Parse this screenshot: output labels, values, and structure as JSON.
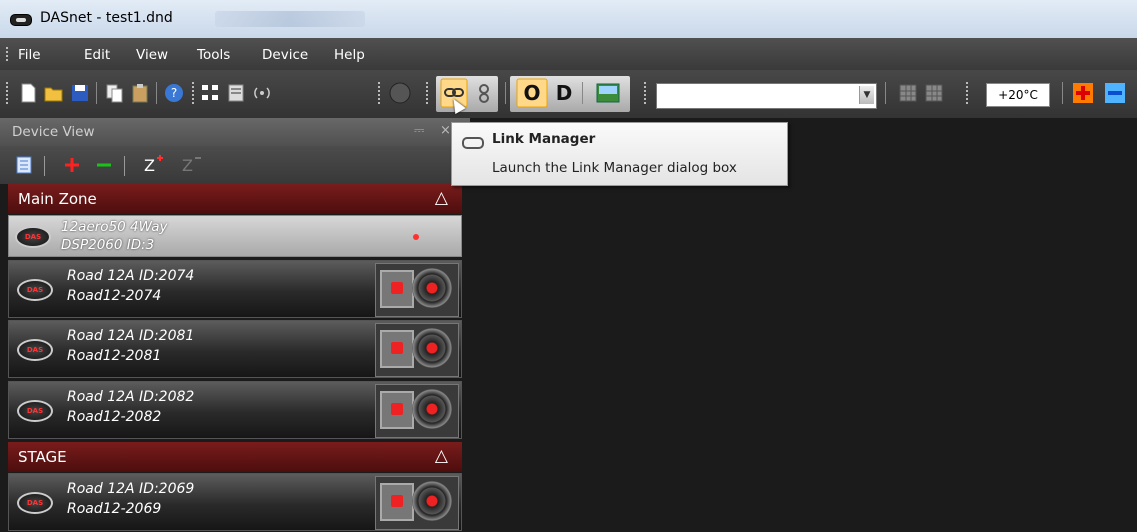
{
  "window": {
    "title": "DASnet - test1.dnd"
  },
  "menu": [
    "File",
    "Edit",
    "View",
    "Tools",
    "Device",
    "Help"
  ],
  "toolbar": {
    "temperature": "+20°C",
    "combo_value": "",
    "link_btn_active": true
  },
  "panel": {
    "title": "Device View",
    "pin": "—",
    "close": "×"
  },
  "tooltip": {
    "title": "Link Manager",
    "description": "Launch the Link Manager dialog box"
  },
  "zones": [
    {
      "name": "Main Zone",
      "arrow": "△"
    },
    {
      "name": "STAGE",
      "arrow": "△"
    }
  ],
  "devices": [
    {
      "line1": "12aero50 4Way",
      "line2": "DSP2060  ID:3"
    },
    {
      "line1": "Road 12A  ID:2074",
      "line2": "Road12-2074"
    },
    {
      "line1": "Road 12A  ID:2081",
      "line2": "Road12-2081"
    },
    {
      "line1": "Road 12A  ID:2082",
      "line2": "Road12-2082"
    },
    {
      "line1": "Road 12A  ID:2069",
      "line2": "Road12-2069"
    }
  ],
  "logo_text": "DAS",
  "colors": {
    "zone_header": "#6b1515",
    "accent_red": "#e22222",
    "accent_blue": "#2a7be0"
  }
}
